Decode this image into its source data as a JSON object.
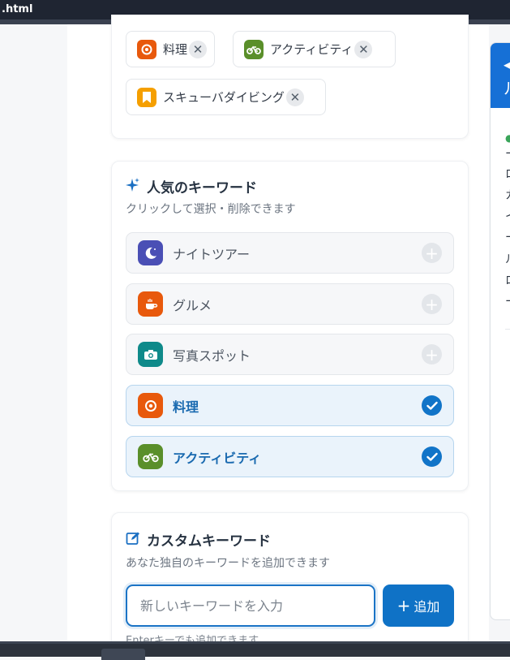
{
  "window": {
    "title": ".html"
  },
  "selected_chips": [
    {
      "label": "料理",
      "icon": "food-icon",
      "color": "#e8590c"
    },
    {
      "label": "アクティビティ",
      "icon": "bicycle-icon",
      "color": "#5a8f2a"
    },
    {
      "label": "スキューバダイビング",
      "icon": "bookmark-icon",
      "color": "#f59f00"
    }
  ],
  "popular": {
    "title": "人気のキーワード",
    "subtitle": "クリックして選択・削除できます",
    "icon": "sparkles-icon",
    "items": [
      {
        "label": "ナイトツアー",
        "icon": "moon-icon",
        "color": "#4a4fb5",
        "selected": false
      },
      {
        "label": "グルメ",
        "icon": "coffee-icon",
        "color": "#e8590c",
        "selected": false
      },
      {
        "label": "写真スポット",
        "icon": "camera-icon",
        "color": "#0f8a8a",
        "selected": false
      },
      {
        "label": "料理",
        "icon": "food-icon",
        "color": "#e8590c",
        "selected": true
      },
      {
        "label": "アクティビティ",
        "icon": "bicycle-icon",
        "color": "#5a8f2a",
        "selected": true
      }
    ]
  },
  "custom": {
    "title": "カスタムキーワード",
    "subtitle": "あなた独自のキーワードを追加できます",
    "icon": "edit-icon",
    "input_placeholder": "新しいキーワードを入力",
    "input_value": "",
    "add_label": "追加",
    "hint": "Enterキーでも追加できます"
  },
  "side_panel": {
    "header_glyphs": [
      "◀",
      "ル"
    ],
    "lines": [
      "ー",
      "ロ",
      "カ",
      "イ",
      "ー",
      "ル",
      "ロ",
      "ー"
    ]
  },
  "colors": {
    "accent": "#1174c8",
    "selected_bg": "#eaf3fb",
    "titlebar": "#1f2532"
  }
}
